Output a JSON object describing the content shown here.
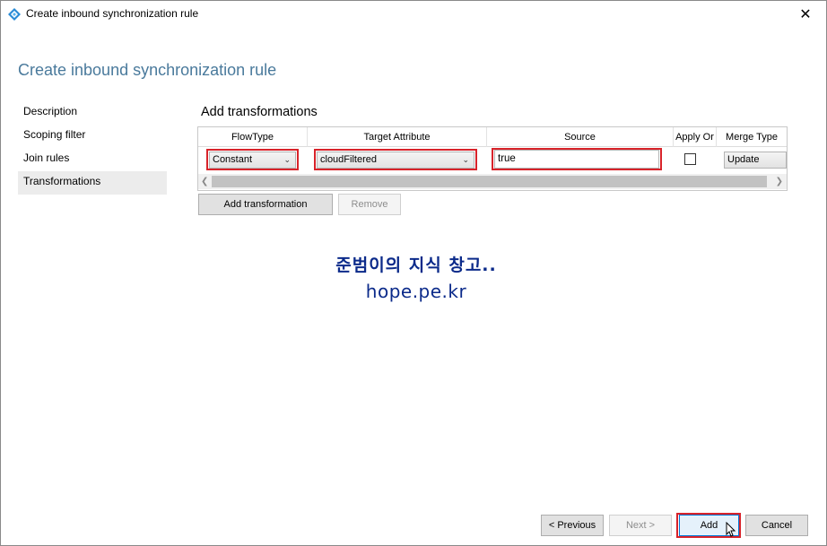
{
  "window": {
    "title": "Create inbound synchronization rule",
    "close_symbol": "✕"
  },
  "page_title": "Create inbound synchronization rule",
  "nav": {
    "items": [
      {
        "label": "Description"
      },
      {
        "label": "Scoping filter"
      },
      {
        "label": "Join rules"
      },
      {
        "label": "Transformations",
        "active": true
      }
    ]
  },
  "section": {
    "title": "Add transformations"
  },
  "grid": {
    "columns": [
      "FlowType",
      "Target Attribute",
      "Source",
      "Apply Or",
      "Merge Type"
    ],
    "rows": [
      {
        "flow_type": "Constant",
        "target_attribute": "cloudFiltered",
        "source": "true",
        "apply_once": false,
        "merge_type": "Update"
      }
    ]
  },
  "grid_buttons": {
    "add_transformation": "Add transformation",
    "remove": "Remove"
  },
  "watermark": {
    "line1": "준범이의 지식 창고..",
    "line2": "hope.pe.kr"
  },
  "footer": {
    "previous": "< Previous",
    "next": "Next >",
    "add": "Add",
    "cancel": "Cancel"
  },
  "colors": {
    "accent": "#0078d7",
    "highlight": "#d8232a",
    "title_blue": "#4a7a9c",
    "watermark": "#0b2a8a"
  }
}
